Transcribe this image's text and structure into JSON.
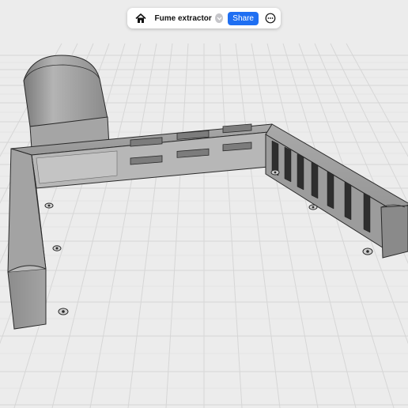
{
  "toolbar": {
    "title": "Fume extractor",
    "share_label": "Share",
    "home_icon": "home-icon",
    "dropdown_icon": "chevron-down-icon",
    "more_icon": "more-options-icon",
    "share_color": "#1f6ff2"
  },
  "viewport": {
    "model": "fume extractor 3d model",
    "background_color": "#ececec",
    "grid_color": "#d5d5d5",
    "model_color": "#8f8f8f"
  }
}
